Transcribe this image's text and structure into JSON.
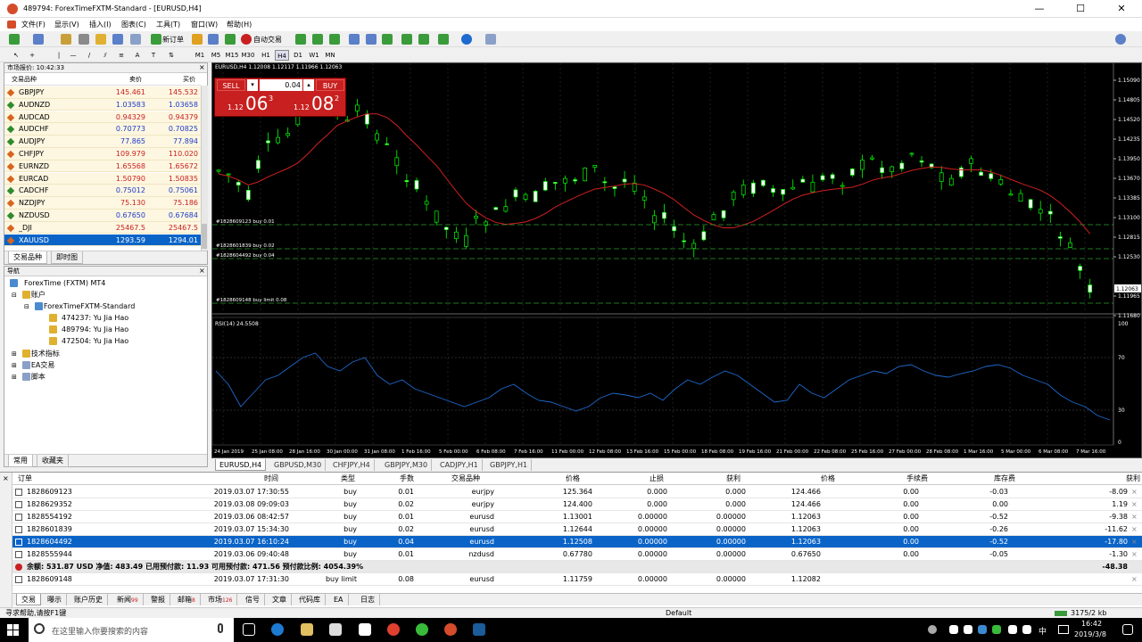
{
  "window": {
    "title": "489794: ForexTimeFXTM-Standard - [EURUSD,H4]",
    "minimize": "—",
    "maximize": "☐",
    "close": "✕"
  },
  "menu": [
    "文件(F)",
    "显示(V)",
    "插入(I)",
    "图表(C)",
    "工具(T)",
    "窗口(W)",
    "帮助(H)"
  ],
  "toolbar": {
    "new_order": "新订单",
    "auto_trade": "自动交易"
  },
  "timeframes": [
    "M1",
    "M5",
    "M15",
    "M30",
    "H1",
    "H4",
    "D1",
    "W1",
    "MN"
  ],
  "market_watch": {
    "header": "市场报价: 10:42:33",
    "col_symbol": "交易品种",
    "col_bid": "卖价",
    "col_ask": "买价",
    "rows": [
      {
        "symbol": "GBPJPY",
        "bid": "145.461",
        "ask": "145.532",
        "dir": "down",
        "color": "#c81e1e"
      },
      {
        "symbol": "AUDNZD",
        "bid": "1.03583",
        "ask": "1.03658",
        "dir": "up",
        "color": "#1e3cc8"
      },
      {
        "symbol": "AUDCAD",
        "bid": "0.94329",
        "ask": "0.94379",
        "dir": "down",
        "color": "#c81e1e"
      },
      {
        "symbol": "AUDCHF",
        "bid": "0.70773",
        "ask": "0.70825",
        "dir": "up",
        "color": "#1e3cc8"
      },
      {
        "symbol": "AUDJPY",
        "bid": "77.865",
        "ask": "77.894",
        "dir": "up",
        "color": "#1e3cc8"
      },
      {
        "symbol": "CHFJPY",
        "bid": "109.979",
        "ask": "110.020",
        "dir": "down",
        "color": "#c81e1e"
      },
      {
        "symbol": "EURNZD",
        "bid": "1.65568",
        "ask": "1.65672",
        "dir": "down",
        "color": "#c81e1e"
      },
      {
        "symbol": "EURCAD",
        "bid": "1.50790",
        "ask": "1.50835",
        "dir": "down",
        "color": "#c81e1e"
      },
      {
        "symbol": "CADCHF",
        "bid": "0.75012",
        "ask": "0.75061",
        "dir": "up",
        "color": "#1e3cc8"
      },
      {
        "symbol": "NZDJPY",
        "bid": "75.130",
        "ask": "75.186",
        "dir": "down",
        "color": "#c81e1e"
      },
      {
        "symbol": "NZDUSD",
        "bid": "0.67650",
        "ask": "0.67684",
        "dir": "up",
        "color": "#1e3cc8"
      },
      {
        "symbol": "_DJI",
        "bid": "25467.5",
        "ask": "25467.5",
        "dir": "down",
        "color": "#c81e1e"
      },
      {
        "symbol": "XAUUSD",
        "bid": "1293.59",
        "ask": "1294.01",
        "dir": "down",
        "color": "#ffffff"
      }
    ],
    "tabs": [
      "交易品种",
      "即时图"
    ]
  },
  "navigator": {
    "header": "导航",
    "root": "ForexTime (FXTM) MT4",
    "accounts": "账户",
    "server": "ForexTimeFXTM-Standard",
    "account_list": [
      "474237: Yu Jia Hao",
      "489794: Yu Jia Hao",
      "472504: Yu Jia Hao"
    ],
    "indicators": "技术指标",
    "ea": "EA交易",
    "scripts": "脚本",
    "tabs": [
      "常用",
      "收藏夹"
    ]
  },
  "chart": {
    "info": "EURUSD,H4  1.12008 1.12117 1.11966 1.12063",
    "sell_label": "SELL",
    "buy_label": "BUY",
    "lot": "0.04",
    "sell_small": "1.12",
    "sell_big": "06",
    "sell_sup": "3",
    "buy_small": "1.12",
    "buy_big": "08",
    "buy_sup": "2",
    "price_labels": [
      "1.15090",
      "1.14805",
      "1.14520",
      "1.14235",
      "1.13950",
      "1.13670",
      "1.13385",
      "1.13100",
      "1.12815",
      "1.12530",
      "1.12063",
      "1.11965",
      "1.11680"
    ],
    "order_lines": [
      "#1828609123 buy 0.01",
      "#1828601839 buy 0.02",
      "#1828604492 buy 0.04",
      "#1828609148 buy limit 0.08"
    ],
    "rsi_label": "RSI(14) 24.5508",
    "rsi_levels": [
      "100",
      "70",
      "30",
      "0"
    ],
    "time_labels": [
      "24 Jan 2019",
      "25 Jan 08:00",
      "28 Jan 16:00",
      "30 Jan 00:00",
      "31 Jan 08:00",
      "1 Feb 16:00",
      "5 Feb 00:00",
      "6 Feb 08:00",
      "7 Feb 16:00",
      "11 Feb 00:00",
      "12 Feb 08:00",
      "13 Feb 16:00",
      "15 Feb 00:00",
      "18 Feb 08:00",
      "19 Feb 16:00",
      "21 Feb 00:00",
      "22 Feb 08:00",
      "25 Feb 16:00",
      "27 Feb 00:00",
      "28 Feb 08:00",
      "1 Mar 16:00",
      "5 Mar 00:00",
      "6 Mar 08:00",
      "7 Mar 16:00"
    ],
    "tabs": [
      "EURUSD,H4",
      "GBPUSD,M30",
      "CHFJPY,H4",
      "GBPJPY,M30",
      "CADJPY,H1",
      "GBPJPY,H1"
    ]
  },
  "terminal": {
    "columns": [
      "订单",
      "时间",
      "类型",
      "手数",
      "交易品种",
      "价格",
      "止损",
      "获利",
      "价格",
      "手续费",
      "库存费",
      "获利"
    ],
    "rows": [
      [
        "1828609123",
        "2019.03.07 17:30:55",
        "buy",
        "0.01",
        "eurjpy",
        "125.364",
        "0.000",
        "0.000",
        "124.466",
        "0.00",
        "-0.03",
        "-8.09"
      ],
      [
        "1828629352",
        "2019.03.08 09:09:03",
        "buy",
        "0.02",
        "eurjpy",
        "124.400",
        "0.000",
        "0.000",
        "124.466",
        "0.00",
        "0.00",
        "1.19"
      ],
      [
        "1828554192",
        "2019.03.06 08:42:57",
        "buy",
        "0.01",
        "eurusd",
        "1.13001",
        "0.00000",
        "0.00000",
        "1.12063",
        "0.00",
        "-0.52",
        "-9.38"
      ],
      [
        "1828601839",
        "2019.03.07 15:34:30",
        "buy",
        "0.02",
        "eurusd",
        "1.12644",
        "0.00000",
        "0.00000",
        "1.12063",
        "0.00",
        "-0.26",
        "-11.62"
      ],
      [
        "1828604492",
        "2019.03.07 16:10:24",
        "buy",
        "0.04",
        "eurusd",
        "1.12508",
        "0.00000",
        "0.00000",
        "1.12063",
        "0.00",
        "-0.52",
        "-17.80"
      ],
      [
        "1828555944",
        "2019.03.06 09:40:48",
        "buy",
        "0.01",
        "nzdusd",
        "0.67780",
        "0.00000",
        "0.00000",
        "0.67650",
        "0.00",
        "-0.05",
        "-1.30"
      ]
    ],
    "summary": "余额: 531.87 USD  净值: 483.49  已用预付款: 11.93  可用预付款: 471.56  预付款比例: 4054.39%",
    "summary_total": "-48.38",
    "pending": [
      "1828609148",
      "2019.03.07 17:31:30",
      "buy limit",
      "0.08",
      "eurusd",
      "1.11759",
      "0.00000",
      "0.00000",
      "1.12082"
    ],
    "tabs": [
      {
        "label": "交易",
        "badge": ""
      },
      {
        "label": "曝示",
        "badge": ""
      },
      {
        "label": "账户历史",
        "badge": ""
      },
      {
        "label": "新闻",
        "badge": "99"
      },
      {
        "label": "警报",
        "badge": ""
      },
      {
        "label": "邮箱",
        "badge": "8"
      },
      {
        "label": "市场",
        "badge": "126"
      },
      {
        "label": "信号",
        "badge": ""
      },
      {
        "label": "文章",
        "badge": ""
      },
      {
        "label": "代码库",
        "badge": ""
      },
      {
        "label": "EA",
        "badge": ""
      },
      {
        "label": "日志",
        "badge": ""
      }
    ]
  },
  "status": {
    "help": "寻求帮助,请按F1键",
    "profile": "Default",
    "traffic": "3175/2 kb"
  },
  "taskbar": {
    "search_placeholder": "在这里输入你要搜索的内容",
    "ime": "中",
    "time": "16:42",
    "date": "2019/3/8"
  }
}
